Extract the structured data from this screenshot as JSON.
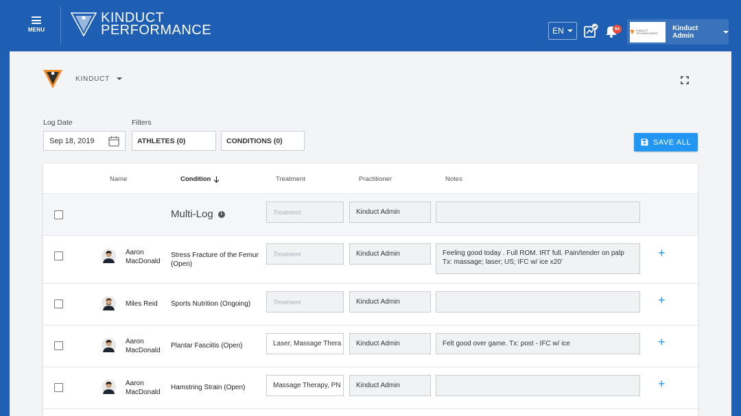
{
  "header": {
    "menu_label": "MENU",
    "brand_line1": "KINDUCT",
    "brand_line2": "PERFORMANCE",
    "language": "EN",
    "notification_count": "64",
    "user_name": "Kinduct Admin",
    "user_logo_text": "KINDUCT TECHNOLOGIES"
  },
  "org": {
    "name": "KINDUCT"
  },
  "filters": {
    "log_date_label": "Log Date",
    "log_date_value": "Sep 18, 2019",
    "filters_label": "Filters",
    "athletes_btn": "ATHLETES (0)",
    "conditions_btn": "CONDITIONS (0)",
    "save_all": "SAVE ALL"
  },
  "table": {
    "columns": {
      "name": "Name",
      "condition": "Condition",
      "treatment": "Treatment",
      "practitioner": "Practitioner",
      "notes": "Notes"
    },
    "multi_log": {
      "label": "Multi-Log",
      "treatment_placeholder": "Treatment",
      "practitioner": "Kinduct Admin",
      "notes": ""
    },
    "rows": [
      {
        "first": "Aaron",
        "last": "MacDonald",
        "condition_line1": "Stress Fracture of the Femur",
        "condition_line2": "(Open)",
        "treatment": "Treatment",
        "practitioner": "Kinduct Admin",
        "notes": "Feeling good today . Full ROM. IRT full. Pain/tender on palp Tx: massage; laser; US; IFC w/ ice x20'"
      },
      {
        "first": "Miles Reid",
        "last": "",
        "condition_line1": "Sports Nutrition (Ongoing)",
        "condition_line2": "",
        "treatment": "Treatment",
        "practitioner": "Kinduct Admin",
        "notes": ""
      },
      {
        "first": "Aaron",
        "last": "MacDonald",
        "condition_line1": "Plantar Fasciitis (Open)",
        "condition_line2": "",
        "treatment": "Laser, Massage Thera",
        "practitioner": "Kinduct Admin",
        "notes": "Felt good over game. Tx: post - IFC w/ ice"
      },
      {
        "first": "Aaron",
        "last": "MacDonald",
        "condition_line1": "Hamstring Strain (Open)",
        "condition_line2": "",
        "treatment": "Massage Therapy, PN",
        "practitioner": "Kinduct Admin",
        "notes": ""
      }
    ],
    "add_symbol": "+"
  },
  "colors": {
    "header_bg": "#1f5fb3",
    "accent": "#2196f3",
    "logo_orange": "#f08c2a",
    "badge": "#e84c3d"
  }
}
